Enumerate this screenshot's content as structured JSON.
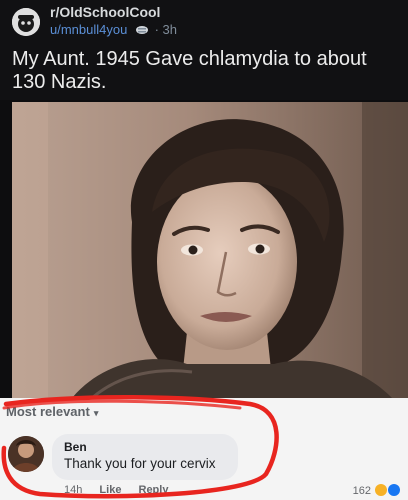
{
  "post": {
    "subreddit": "r/OldSchoolCool",
    "username": "u/mnbull4you",
    "separator": "·",
    "age": "3h",
    "title": "My Aunt.  1945  Gave chlamydia to about 130 Nazis."
  },
  "photo": {
    "subject": "vintage black-and-white portrait of a woman"
  },
  "comments": {
    "sort_label": "Most relevant",
    "items": [
      {
        "author": "Ben",
        "text": "Thank you for your cervix",
        "time": "14h",
        "like_label": "Like",
        "reply_label": "Reply",
        "reaction_count": "162"
      }
    ]
  },
  "colors": {
    "reddit_bg": "#111113",
    "username": "#5b8fd6",
    "highlight": "#e8251f",
    "comment_bg": "#f4f4f4"
  }
}
